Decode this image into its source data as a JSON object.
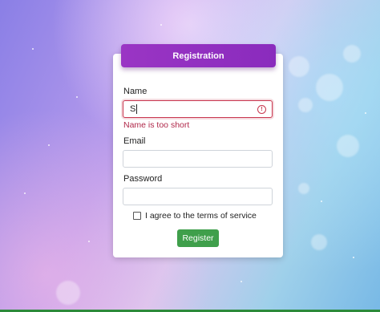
{
  "form": {
    "title": "Registration",
    "name_label": "Name",
    "name_value": "S",
    "name_error": "Name is too short",
    "email_label": "Email",
    "email_value": "",
    "password_label": "Password",
    "password_value": "",
    "terms_label": "I agree to the terms of service",
    "terms_checked": false,
    "submit_label": "Register"
  },
  "icons": {
    "error": "alert-circle-icon"
  },
  "colors": {
    "header": "#9a35c4",
    "error": "#c8374f",
    "button": "#3f9f4b"
  }
}
